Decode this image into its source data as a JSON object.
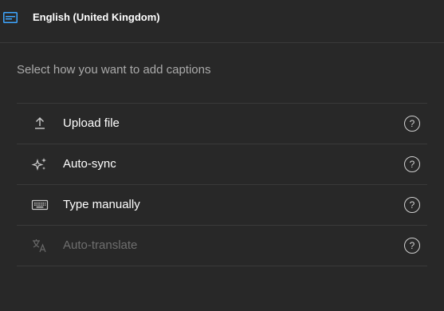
{
  "header": {
    "language": "English (United Kingdom)",
    "icon": "subtitles-icon"
  },
  "prompt": "Select how you want to add captions",
  "options": [
    {
      "label": "Upload file",
      "icon": "upload-icon",
      "help": "?",
      "enabled": true
    },
    {
      "label": "Auto-sync",
      "icon": "sparkle-icon",
      "help": "?",
      "enabled": true
    },
    {
      "label": "Type manually",
      "icon": "keyboard-icon",
      "help": "?",
      "enabled": true
    },
    {
      "label": "Auto-translate",
      "icon": "translate-icon",
      "help": "?",
      "enabled": false
    }
  ],
  "colors": {
    "background": "#282828",
    "divider": "#3a3a3a",
    "text": "#ffffff",
    "muted_text": "#aaaaaa",
    "disabled_text": "#6e6e6e",
    "accent": "#3ea6ff"
  }
}
